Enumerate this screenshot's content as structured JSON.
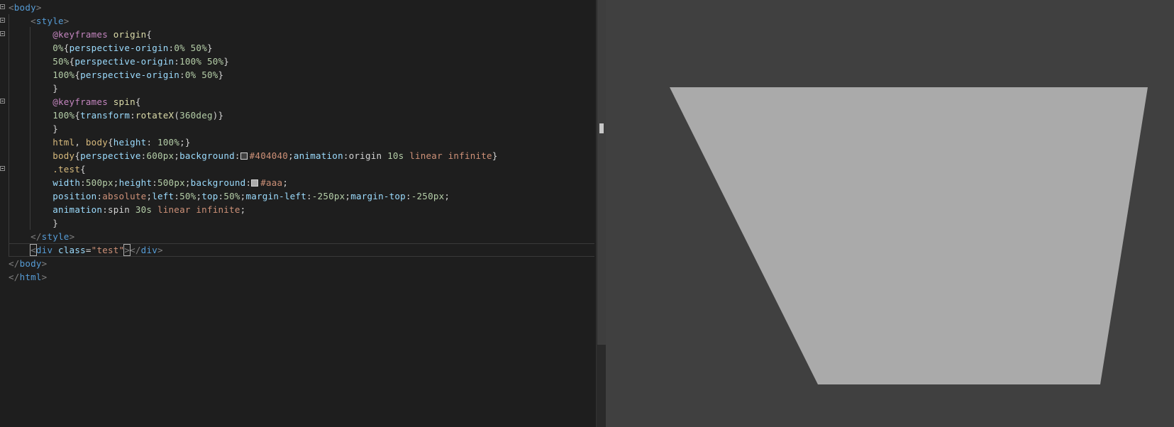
{
  "editor": {
    "lines": [
      [
        [
          "t-punc",
          "<"
        ],
        [
          "t-tag",
          "body"
        ],
        [
          "t-punc",
          ">"
        ]
      ],
      [
        [
          "t-txt",
          "    "
        ],
        [
          "t-punc",
          "<"
        ],
        [
          "t-tag",
          "style"
        ],
        [
          "t-punc",
          ">"
        ]
      ],
      [
        [
          "t-txt",
          "        "
        ],
        [
          "t-at",
          "@keyframes"
        ],
        [
          "t-txt",
          " "
        ],
        [
          "t-name",
          "origin"
        ],
        [
          "t-txt",
          "{"
        ]
      ],
      [
        [
          "t-txt",
          "        "
        ],
        [
          "t-num",
          "0%"
        ],
        [
          "t-txt",
          "{"
        ],
        [
          "t-prop",
          "perspective-origin"
        ],
        [
          "t-txt",
          ":"
        ],
        [
          "t-num",
          "0%"
        ],
        [
          "t-txt",
          " "
        ],
        [
          "t-num",
          "50%"
        ],
        [
          "t-txt",
          "}"
        ]
      ],
      [
        [
          "t-txt",
          "        "
        ],
        [
          "t-num",
          "50%"
        ],
        [
          "t-txt",
          "{"
        ],
        [
          "t-prop",
          "perspective-origin"
        ],
        [
          "t-txt",
          ":"
        ],
        [
          "t-num",
          "100%"
        ],
        [
          "t-txt",
          " "
        ],
        [
          "t-num",
          "50%"
        ],
        [
          "t-txt",
          "}"
        ]
      ],
      [
        [
          "t-txt",
          "        "
        ],
        [
          "t-num",
          "100%"
        ],
        [
          "t-txt",
          "{"
        ],
        [
          "t-prop",
          "perspective-origin"
        ],
        [
          "t-txt",
          ":"
        ],
        [
          "t-num",
          "0%"
        ],
        [
          "t-txt",
          " "
        ],
        [
          "t-num",
          "50%"
        ],
        [
          "t-txt",
          "}"
        ]
      ],
      [
        [
          "t-txt",
          "        }"
        ]
      ],
      [
        [
          "t-txt",
          "        "
        ],
        [
          "t-at",
          "@keyframes"
        ],
        [
          "t-txt",
          " "
        ],
        [
          "t-name",
          "spin"
        ],
        [
          "t-txt",
          "{"
        ]
      ],
      [
        [
          "t-txt",
          "        "
        ],
        [
          "t-num",
          "100%"
        ],
        [
          "t-txt",
          "{"
        ],
        [
          "t-prop",
          "transform"
        ],
        [
          "t-txt",
          ":"
        ],
        [
          "t-name",
          "rotateX"
        ],
        [
          "t-txt",
          "("
        ],
        [
          "t-num",
          "360deg"
        ],
        [
          "t-txt",
          ")}"
        ]
      ],
      [
        [
          "t-txt",
          "        }"
        ]
      ],
      [
        [
          "t-txt",
          "        "
        ],
        [
          "t-sel",
          "html"
        ],
        [
          "t-txt",
          ", "
        ],
        [
          "t-sel",
          "body"
        ],
        [
          "t-txt",
          "{"
        ],
        [
          "t-prop",
          "height"
        ],
        [
          "t-txt",
          ": "
        ],
        [
          "t-num",
          "100%"
        ],
        [
          "t-txt",
          ";}"
        ]
      ],
      [
        [
          "t-txt",
          "        "
        ],
        [
          "t-sel",
          "body"
        ],
        [
          "t-txt",
          "{"
        ],
        [
          "t-prop",
          "perspective"
        ],
        [
          "t-txt",
          ":"
        ],
        [
          "t-num",
          "600px"
        ],
        [
          "t-txt",
          ";"
        ],
        [
          "t-prop",
          "background"
        ],
        [
          "t-txt",
          ":"
        ],
        [
          "swatch",
          "#404040"
        ],
        [
          "t-val",
          "#404040"
        ],
        [
          "t-txt",
          ";"
        ],
        [
          "t-prop",
          "animation"
        ],
        [
          "t-txt",
          ":origin "
        ],
        [
          "t-num",
          "10s"
        ],
        [
          "t-txt",
          " "
        ],
        [
          "t-val",
          "linear"
        ],
        [
          "t-txt",
          " "
        ],
        [
          "t-val",
          "infinite"
        ],
        [
          "t-txt",
          "}"
        ]
      ],
      [
        [
          "t-txt",
          "        "
        ],
        [
          "t-sel",
          ".test"
        ],
        [
          "t-txt",
          "{"
        ]
      ],
      [
        [
          "t-txt",
          "        "
        ],
        [
          "t-prop",
          "width"
        ],
        [
          "t-txt",
          ":"
        ],
        [
          "t-num",
          "500px"
        ],
        [
          "t-txt",
          ";"
        ],
        [
          "t-prop",
          "height"
        ],
        [
          "t-txt",
          ":"
        ],
        [
          "t-num",
          "500px"
        ],
        [
          "t-txt",
          ";"
        ],
        [
          "t-prop",
          "background"
        ],
        [
          "t-txt",
          ":"
        ],
        [
          "swatch",
          "#aaaaaa"
        ],
        [
          "t-val",
          "#aaa"
        ],
        [
          "t-txt",
          ";"
        ]
      ],
      [
        [
          "t-txt",
          "        "
        ],
        [
          "t-prop",
          "position"
        ],
        [
          "t-txt",
          ":"
        ],
        [
          "t-val",
          "absolute"
        ],
        [
          "t-txt",
          ";"
        ],
        [
          "t-prop",
          "left"
        ],
        [
          "t-txt",
          ":"
        ],
        [
          "t-num",
          "50%"
        ],
        [
          "t-txt",
          ";"
        ],
        [
          "t-prop",
          "top"
        ],
        [
          "t-txt",
          ":"
        ],
        [
          "t-num",
          "50%"
        ],
        [
          "t-txt",
          ";"
        ],
        [
          "t-prop",
          "margin-left"
        ],
        [
          "t-txt",
          ":"
        ],
        [
          "t-num",
          "-250px"
        ],
        [
          "t-txt",
          ";"
        ],
        [
          "t-prop",
          "margin-top"
        ],
        [
          "t-txt",
          ":"
        ],
        [
          "t-num",
          "-250px"
        ],
        [
          "t-txt",
          ";"
        ]
      ],
      [
        [
          "t-txt",
          "        "
        ],
        [
          "t-prop",
          "animation"
        ],
        [
          "t-txt",
          ":spin "
        ],
        [
          "t-num",
          "30s"
        ],
        [
          "t-txt",
          " "
        ],
        [
          "t-val",
          "linear"
        ],
        [
          "t-txt",
          " "
        ],
        [
          "t-val",
          "infinite"
        ],
        [
          "t-txt",
          ";"
        ]
      ],
      [
        [
          "t-txt",
          "        }"
        ]
      ],
      [
        [
          "t-txt",
          "    "
        ],
        [
          "t-punc",
          "</"
        ],
        [
          "t-tag",
          "style"
        ],
        [
          "t-punc",
          ">"
        ]
      ],
      [
        [
          "t-txt",
          "    "
        ],
        [
          "t-caret",
          "<"
        ],
        [
          "t-tag",
          "div"
        ],
        [
          "t-txt",
          " "
        ],
        [
          "t-attr",
          "class"
        ],
        [
          "t-txt",
          "="
        ],
        [
          "t-str",
          "\"test\""
        ],
        [
          "t-caret",
          ">"
        ],
        [
          "t-punc",
          "</"
        ],
        [
          "t-tag",
          "div"
        ],
        [
          "t-punc",
          ">"
        ]
      ],
      [
        [
          "t-punc",
          "</"
        ],
        [
          "t-tag",
          "body"
        ],
        [
          "t-punc",
          ">"
        ]
      ],
      [
        [
          "t-punc",
          "</"
        ],
        [
          "t-tag",
          "html"
        ],
        [
          "t-punc",
          ">"
        ]
      ]
    ],
    "current_line": 18
  },
  "preview": {
    "background": "#404040",
    "shape_color": "#aaaaaa"
  }
}
